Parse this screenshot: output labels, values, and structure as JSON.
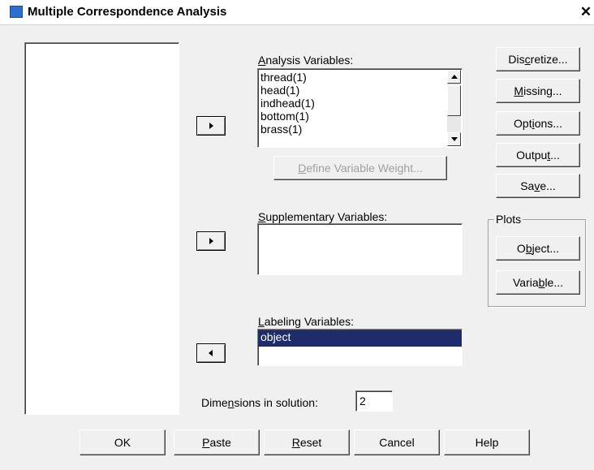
{
  "window": {
    "title": "Multiple Correspondence Analysis",
    "close_glyph": "✕"
  },
  "analysis": {
    "label_pre": "",
    "label_u": "A",
    "label_post": "nalysis Variables:",
    "items": [
      "thread(1)",
      "head(1)",
      "indhead(1)",
      "bottom(1)",
      "brass(1)"
    ],
    "define_weight_u": "D",
    "define_weight_rest": "efine Variable Weight..."
  },
  "supplementary": {
    "label_u": "S",
    "label_post": "upplementary Variables:"
  },
  "labeling": {
    "label_u": "L",
    "label_post": "abeling Variables:",
    "items": [
      "object"
    ]
  },
  "dimensions": {
    "label_pre": "Dime",
    "label_u": "n",
    "label_post": "sions in solution:",
    "value": "2"
  },
  "side_buttons": {
    "discretize": {
      "pre": "Dis",
      "u": "c",
      "post": "retize..."
    },
    "missing": {
      "pre": "",
      "u": "M",
      "post": "issing..."
    },
    "options": {
      "pre": "Opt",
      "u": "i",
      "post": "ons..."
    },
    "output": {
      "pre": "Outpu",
      "u": "t",
      "post": "..."
    },
    "save": {
      "pre": "Sa",
      "u": "v",
      "post": "e..."
    }
  },
  "plots": {
    "title": "Plots",
    "object": {
      "pre": "O",
      "u": "b",
      "post": "ject..."
    },
    "variable": {
      "pre": "Varia",
      "u": "b",
      "post": "le..."
    }
  },
  "bottom_buttons": {
    "ok": "OK",
    "paste": {
      "u": "P",
      "post": "aste"
    },
    "reset": {
      "u": "R",
      "post": "eset"
    },
    "cancel": "Cancel",
    "help": "Help"
  },
  "icons": {
    "window_icon": "window-icon",
    "move_right": "arrow-right-icon",
    "move_left": "arrow-left-icon"
  }
}
